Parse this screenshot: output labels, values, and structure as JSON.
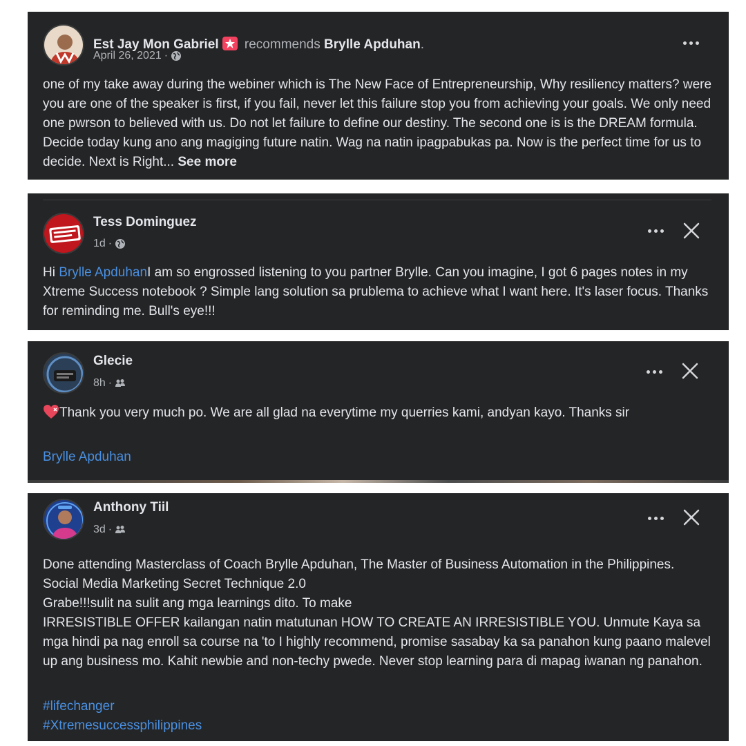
{
  "posts": [
    {
      "author": "Est Jay Mon Gabriel",
      "action": "recommends",
      "target": "Brylle Apduhan",
      "target_suffix": ".",
      "time": "April 26, 2021",
      "separator": " · ",
      "privacy_icon": "globe-icon",
      "avatar_icon": "profile-photo",
      "badge_icon": "star-badge-icon",
      "text": "one of my take away during the webiner which is The New Face of Entrepreneurship, Why resiliency matters? were you are one of the speaker is first, if you fail, never let this failure stop you from achieving your goals. We only need one pwrson to believed with us. Do not let failure to define our destiny. The second one is is the DREAM formula. Decide today kung ano ang magiging future natin. Wag na natin ipagpabukas pa. Now is the perfect time for us to decide. Next is Right...",
      "see_more": "See more",
      "colors": {
        "badge": "#f3425f"
      }
    },
    {
      "author": "Tess Dominguez",
      "time": "1d",
      "separator": " · ",
      "privacy_icon": "globe-icon",
      "avatar_icon": "brand-logo-avatar",
      "greeting": "Hi ",
      "mention": "Brylle Apduhan",
      "text": "I am so engrossed listening to you partner Brylle. Can you imagine, I got 6 pages notes in my Xtreme Success notebook ? Simple lang solution sa prublema to achieve what I want here. It's laser focus. Thanks for reminding me. Bull's eye!!!"
    },
    {
      "author": "Glecie",
      "time": "8h",
      "separator": " · ",
      "privacy_icon": "friends-icon",
      "avatar_icon": "profile-photo",
      "emoji_icon": "heart-emoji-icon",
      "text": "Thank you very much po. We are all glad na everytime my querries kami, andyan kayo. Thanks sir",
      "tag": "Brylle Apduhan"
    },
    {
      "author": "Anthony Tiil",
      "time": "3d",
      "separator": " · ",
      "privacy_icon": "friends-icon",
      "avatar_icon": "profile-photo",
      "text": "Done attending Masterclass of Coach Brylle Apduhan, The Master of Business Automation in the Philippines. Social Media Marketing Secret Technique 2.0\nGrabe!!!sulit na sulit ang mga learnings dito. To make\nIRRESISTIBLE OFFER kailangan natin matutunan HOW TO CREATE AN IRRESISTIBLE YOU. Unmute Kaya sa mga hindi pa nag enroll sa course na 'to I highly recommend, promise sasabay ka sa panahon kung paano malevel up ang business mo. Kahit newbie and non-techy pwede. Never stop learning para di mapag iwanan ng panahon.",
      "hashtags": [
        "#lifechanger",
        "#Xtremesuccessphilippines"
      ]
    }
  ],
  "controls": {
    "more_icon": "more-options-icon",
    "close_icon": "close-icon"
  },
  "theme": {
    "card_bg": "#242526",
    "text": "#e4e6eb",
    "muted": "#b0b3b8",
    "link": "#4a90e2"
  }
}
